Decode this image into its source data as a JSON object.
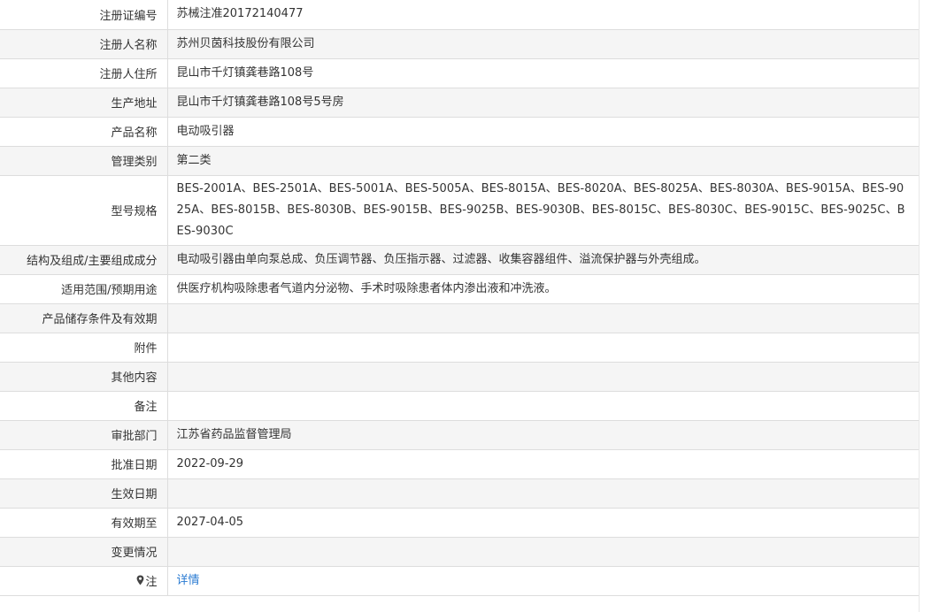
{
  "rows": [
    {
      "label": "注册证编号",
      "value": "苏械注准20172140477"
    },
    {
      "label": "注册人名称",
      "value": "苏州贝茵科技股份有限公司"
    },
    {
      "label": "注册人住所",
      "value": "昆山市千灯镇龚巷路108号"
    },
    {
      "label": "生产地址",
      "value": "昆山市千灯镇龚巷路108号5号房"
    },
    {
      "label": "产品名称",
      "value": "电动吸引器"
    },
    {
      "label": "管理类别",
      "value": "第二类"
    },
    {
      "label": "型号规格",
      "value": "BES-2001A、BES-2501A、BES-5001A、BES-5005A、BES-8015A、BES-8020A、BES-8025A、BES-8030A、BES-9015A、BES-9025A、BES-8015B、BES-8030B、BES-9015B、BES-9025B、BES-9030B、BES-8015C、BES-8030C、BES-9015C、BES-9025C、BES-9030C"
    },
    {
      "label": "结构及组成/主要组成成分",
      "value": "电动吸引器由单向泵总成、负压调节器、负压指示器、过滤器、收集容器组件、溢流保护器与外壳组成。"
    },
    {
      "label": "适用范围/预期用途",
      "value": "供医疗机构吸除患者气道内分泌物、手术时吸除患者体内渗出液和冲洗液。"
    },
    {
      "label": "产品储存条件及有效期",
      "value": ""
    },
    {
      "label": "附件",
      "value": ""
    },
    {
      "label": "其他内容",
      "value": ""
    },
    {
      "label": "备注",
      "value": ""
    },
    {
      "label": "审批部门",
      "value": "江苏省药品监督管理局"
    },
    {
      "label": "批准日期",
      "value": "2022-09-29"
    },
    {
      "label": "生效日期",
      "value": ""
    },
    {
      "label": "有效期至",
      "value": "2027-04-05"
    },
    {
      "label": "变更情况",
      "value": ""
    }
  ],
  "note": {
    "label": "注",
    "icon": "pin-icon",
    "link_text": "详情",
    "link_color": "#2a7bd2"
  }
}
